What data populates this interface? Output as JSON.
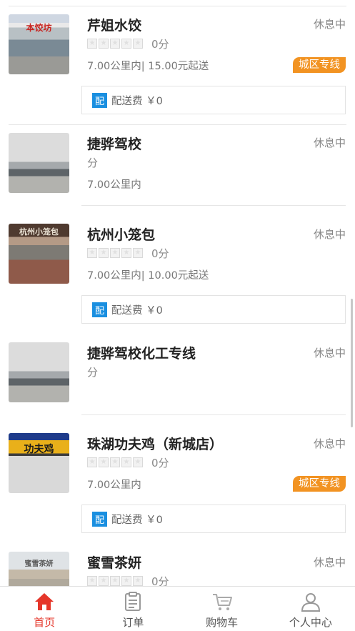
{
  "stores": [
    {
      "name": "芹姐水饺",
      "status": "休息中",
      "show_stars": true,
      "score": "0分",
      "distance": "7.00公里内| 15.00元起送",
      "badge": "城区专线",
      "delivery_icon": "配",
      "delivery_fee": "配送费 ￥0",
      "thumb_text": "本饺坊"
    },
    {
      "name": "捷骅驾校",
      "status": "休息中",
      "show_stars": false,
      "score": "分",
      "distance": "7.00公里内"
    },
    {
      "name": "杭州小笼包",
      "status": "休息中",
      "show_stars": true,
      "score": "0分",
      "distance": "7.00公里内| 10.00元起送",
      "delivery_icon": "配",
      "delivery_fee": "配送费 ￥0",
      "thumb_text": "杭州小笼包"
    },
    {
      "name": "捷骅驾校化工专线",
      "status": "休息中",
      "show_stars": false,
      "score": "分"
    },
    {
      "name": "珠湖功夫鸡（新城店）",
      "status": "休息中",
      "show_stars": true,
      "score": "0分",
      "distance": "7.00公里内",
      "badge": "城区专线",
      "delivery_icon": "配",
      "delivery_fee": "配送费 ￥0",
      "thumb_text": "功夫鸡"
    },
    {
      "name": "蜜雪茶妍",
      "status": "休息中",
      "show_stars": true,
      "score": "0分",
      "thumb_text": "蜜雪茶妍"
    }
  ],
  "star_glyph": "★",
  "tabs": [
    {
      "label": "首页",
      "icon": "home-icon",
      "active": true
    },
    {
      "label": "订单",
      "icon": "order-icon",
      "active": false
    },
    {
      "label": "购物车",
      "icon": "cart-icon",
      "active": false
    },
    {
      "label": "个人中心",
      "icon": "user-icon",
      "active": false
    }
  ],
  "colors": {
    "accent": "#e5362a",
    "badge": "#f29322",
    "delivery_icon": "#1a8fe0"
  }
}
